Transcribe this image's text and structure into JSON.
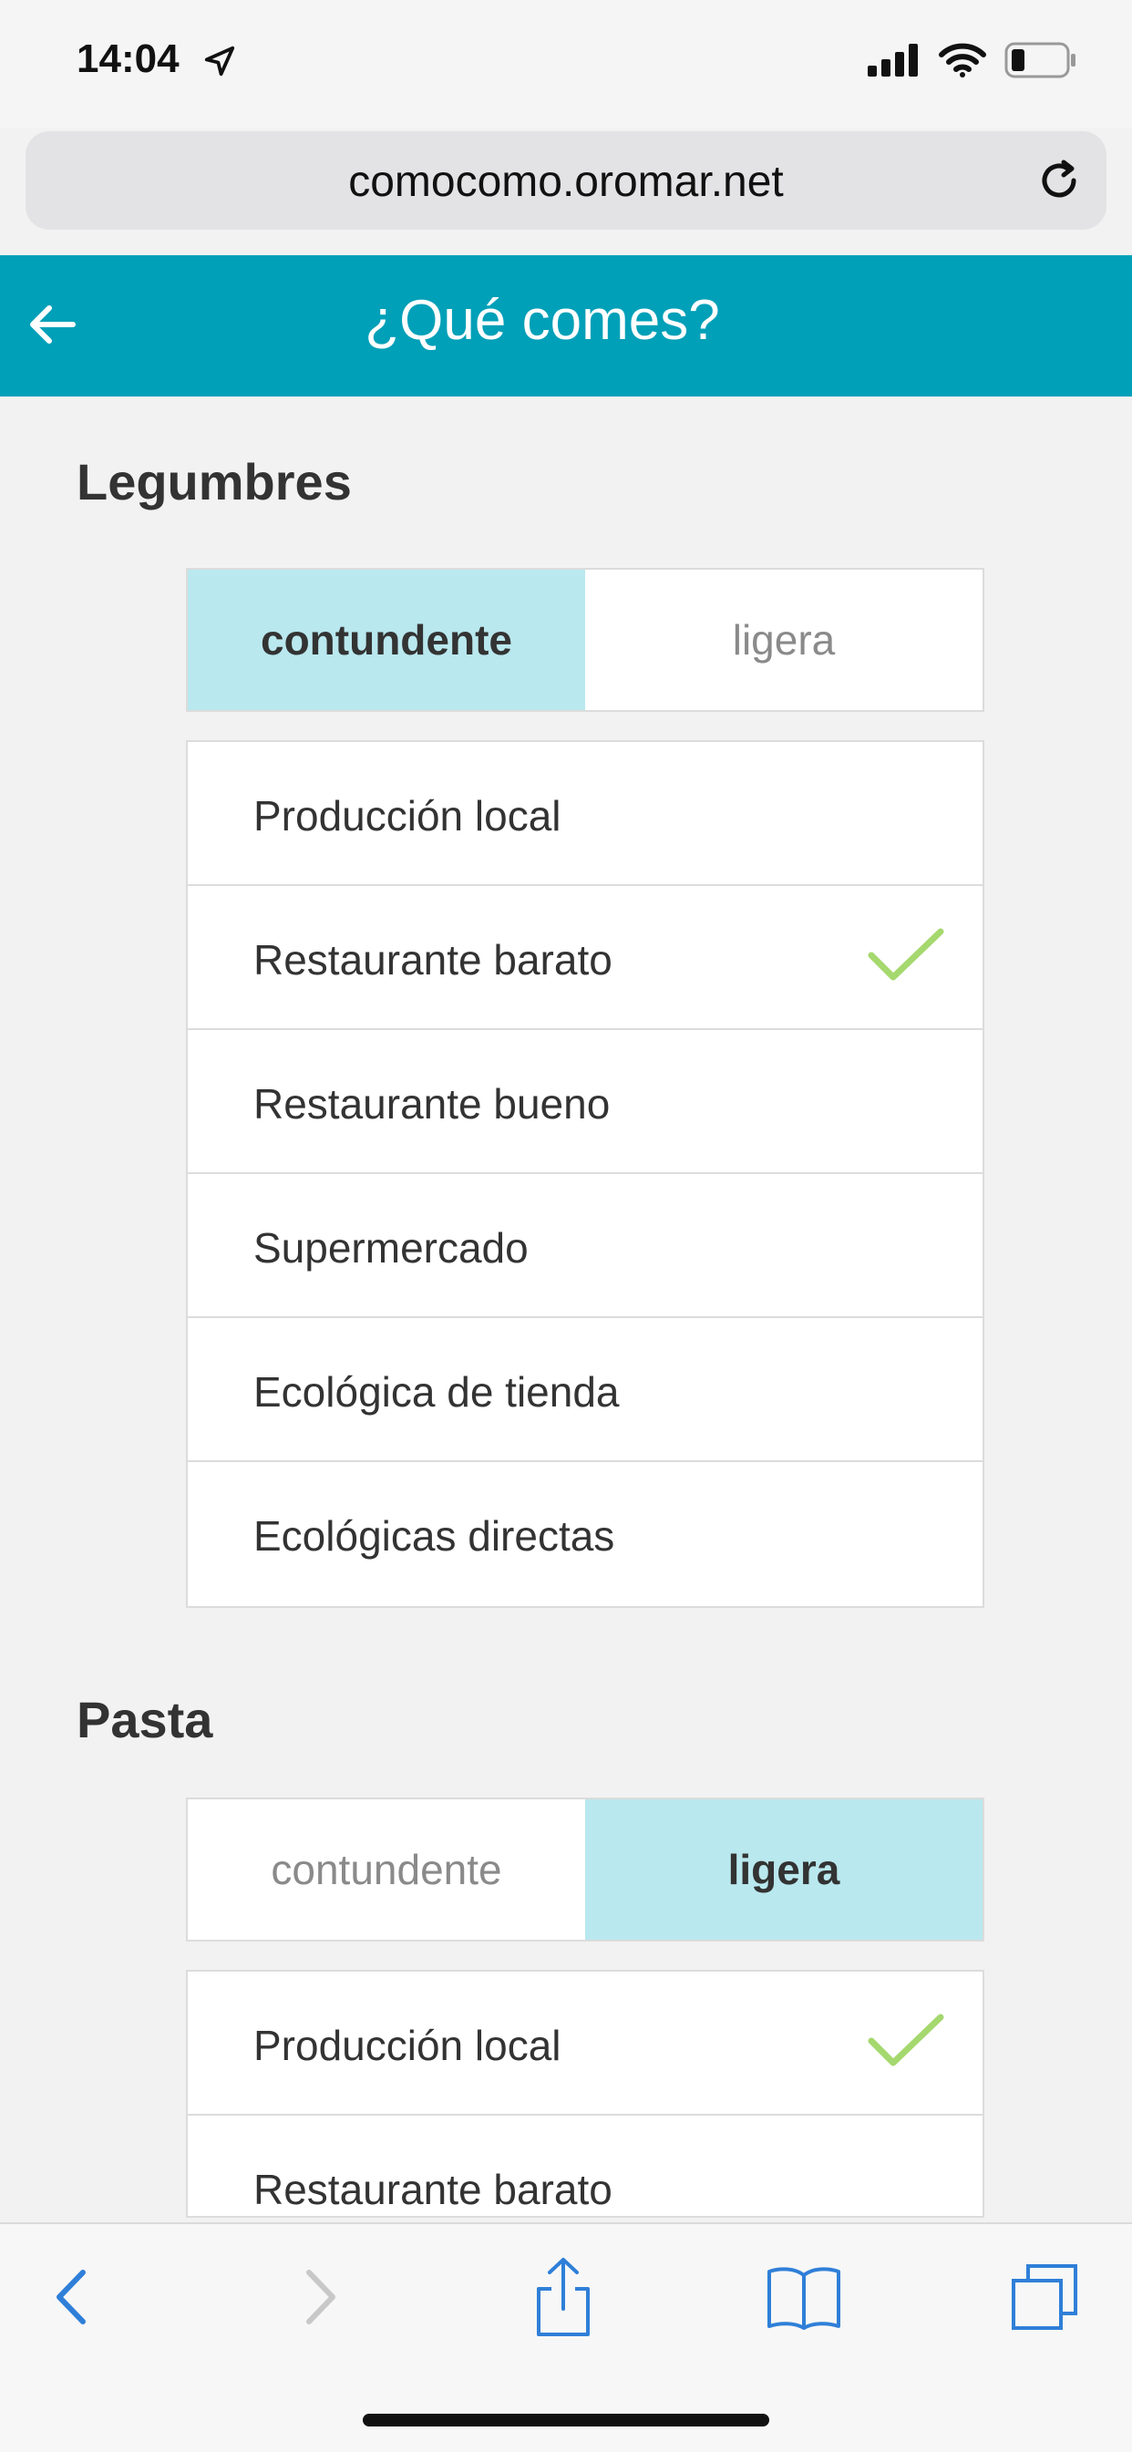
{
  "status_bar": {
    "time": "14:04"
  },
  "browser": {
    "url": "comocomo.oromar.net"
  },
  "header": {
    "title": "¿Qué comes?"
  },
  "sections": [
    {
      "title": "Legumbres",
      "toggle": {
        "options": [
          "contundente",
          "ligera"
        ],
        "selected": "contundente"
      },
      "options": [
        {
          "label": "Producción local",
          "checked": false
        },
        {
          "label": "Restaurante barato",
          "checked": true
        },
        {
          "label": "Restaurante bueno",
          "checked": false
        },
        {
          "label": "Supermercado",
          "checked": false
        },
        {
          "label": "Ecológica de tienda",
          "checked": false
        },
        {
          "label": "Ecológicas directas",
          "checked": false
        }
      ]
    },
    {
      "title": "Pasta",
      "toggle": {
        "options": [
          "contundente",
          "ligera"
        ],
        "selected": "ligera"
      },
      "options": [
        {
          "label": "Producción local",
          "checked": true
        },
        {
          "label": "Restaurante barato",
          "checked": false
        }
      ]
    }
  ],
  "colors": {
    "header_bg": "#00a0b8",
    "toggle_active_bg": "#b9e8ee",
    "check_color": "#a5d86e",
    "toolbar_icon": "#2f7fd8"
  },
  "icons": {
    "back": "arrow-left-icon",
    "check": "check-icon",
    "toolbar": [
      "chevron-left-icon",
      "chevron-right-icon",
      "share-icon",
      "bookmarks-icon",
      "tabs-icon"
    ]
  }
}
